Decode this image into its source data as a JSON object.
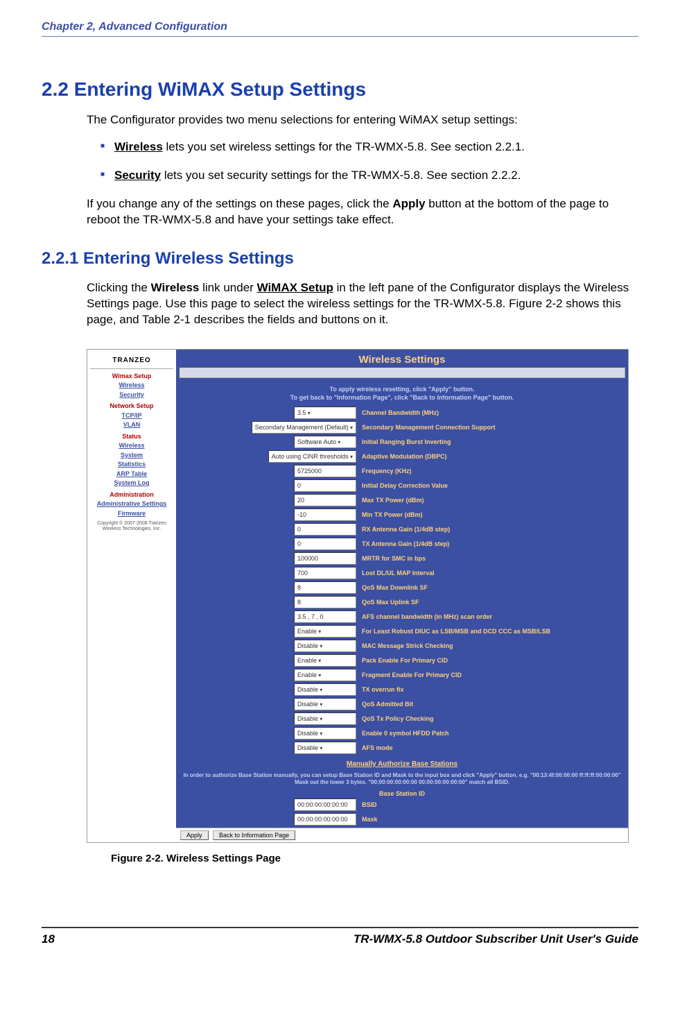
{
  "running_header": "Chapter 2, Advanced Configuration",
  "section_2_2": {
    "title": "2.2 Entering WiMAX Setup Settings",
    "intro": "The Configurator provides two menu selections for entering WiMAX setup settings:",
    "bullets": [
      {
        "bold": "Wireless",
        "rest": " lets you set wireless settings for the TR-WMX-5.8. See section 2.2.1."
      },
      {
        "bold": "Security",
        "rest": " lets you set security settings for the TR-WMX-5.8. See section 2.2.2."
      }
    ],
    "para2_pre": "If you change any of the settings on these pages, click the ",
    "para2_bold": "Apply",
    "para2_post": " button at the bottom of the page to reboot the TR-WMX-5.8 and have your settings take effect."
  },
  "section_2_2_1": {
    "title": "2.2.1 Entering Wireless Settings",
    "para_pre1": "Clicking the ",
    "para_b1": "Wireless",
    "para_mid1": " link under ",
    "para_b2": "WiMAX Setup",
    "para_post": " in the left pane of the Configurator displays the Wireless Settings page. Use this page to select the wireless settings for the TR-WMX-5.8. Figure 2-2 shows this page, and Table 2-1 describes the fields and buttons on it."
  },
  "screenshot": {
    "logo": "TRANZEO",
    "sidebar": {
      "groups": [
        {
          "head": "Wimax Setup",
          "links": [
            "Wireless",
            "Security"
          ]
        },
        {
          "head": "Network Setup",
          "links": [
            "TCP/IP",
            "VLAN"
          ]
        },
        {
          "head": "Status",
          "links": [
            "Wireless",
            "System",
            "Statistics",
            "ARP Table",
            "System Log"
          ]
        },
        {
          "head": "Administration",
          "links": [
            "Administrative Settings",
            "Firmware"
          ]
        }
      ],
      "copyright": "Copyright © 2007-2008 Tranzeo Wireless Technologies, Inc."
    },
    "main_title": "Wireless Settings",
    "note_line1": "To apply wireless resetting, click \"Apply\" button.",
    "note_line2": "To get back to \"Information Page\", click \"Back to Information Page\" button.",
    "rows": [
      {
        "field": "3.5",
        "drop": true,
        "label": "Channel Bandwidth (MHz)"
      },
      {
        "field": "Secondary Management (Default)",
        "drop": true,
        "label": "Secondary Management Connection Support"
      },
      {
        "field": "Software Auto",
        "drop": true,
        "label": "Initial Ranging Burst Inverting"
      },
      {
        "field": "Auto using CINR thresholds",
        "drop": true,
        "label": "Adaptive Modulation (DBPC)"
      },
      {
        "field": "5725000",
        "drop": false,
        "label": "Frequency (KHz)"
      },
      {
        "field": "0",
        "drop": false,
        "label": "Initial Delay Correction Value"
      },
      {
        "field": "20",
        "drop": false,
        "label": "Max TX Power (dBm)"
      },
      {
        "field": "-10",
        "drop": false,
        "label": "Min TX Power (dBm)"
      },
      {
        "field": "0",
        "drop": false,
        "label": "RX Antenna Gain (1/4dB step)"
      },
      {
        "field": "0",
        "drop": false,
        "label": "TX Antenna Gain (1/4dB step)"
      },
      {
        "field": "100000",
        "drop": false,
        "label": "MRTR for SMC in bps"
      },
      {
        "field": "700",
        "drop": false,
        "label": "Lost DL/UL MAP Interval"
      },
      {
        "field": "8",
        "drop": false,
        "label": "QoS Max Downlink SF"
      },
      {
        "field": "8",
        "drop": false,
        "label": "QoS Max Uplink SF"
      },
      {
        "field": "3.5   , 7     , 0",
        "drop": false,
        "label": "AFS channel bandwidth (in MHz) scan order"
      },
      {
        "field": "Enable",
        "drop": true,
        "label": "For Least Robust DIUC as LSB/MSB and DCD CCC as MSB/LSB"
      },
      {
        "field": "Disable",
        "drop": true,
        "label": "MAC Message Strick Checking"
      },
      {
        "field": "Enable",
        "drop": true,
        "label": "Pack Enable For Primary CID"
      },
      {
        "field": "Enable",
        "drop": true,
        "label": "Fragment Enable For Primary CID"
      },
      {
        "field": "Disable",
        "drop": true,
        "label": "TX overrun fix"
      },
      {
        "field": "Disable",
        "drop": true,
        "label": "QoS Admitted Bit"
      },
      {
        "field": "Disable",
        "drop": true,
        "label": "QoS Tx Policy Checking"
      },
      {
        "field": "Disable",
        "drop": true,
        "label": "Enable 0 symbol HFDD Patch"
      },
      {
        "field": "Disable",
        "drop": true,
        "label": "AFS mode"
      }
    ],
    "auth_head": "Manually Authorize Base Stations",
    "auth_note": "In order to authorize Base Station manually, you can setup Base Station ID and Mask to the input box and click \"Apply\" button. e.g. \"00:13:4f:00:00:00 ff:ff:ff:00:00:00\" Mask out the lower 3 bytes. \"00:00:00:00:00:00 00:00:00:00:00:00\" match all BSID.",
    "bsid_head": "Base Station ID",
    "bsid_rows": [
      {
        "field": "00:00:00:00:00:00",
        "label": "BSID"
      },
      {
        "field": "00:00:00:00:00:00",
        "label": "Mask"
      }
    ],
    "btn_apply": "Apply",
    "btn_back": "Back to Information Page"
  },
  "figure_caption": "Figure 2-2. Wireless Settings Page",
  "footer": {
    "page_num": "18",
    "title": "TR-WMX-5.8 Outdoor Subscriber Unit User's Guide"
  }
}
